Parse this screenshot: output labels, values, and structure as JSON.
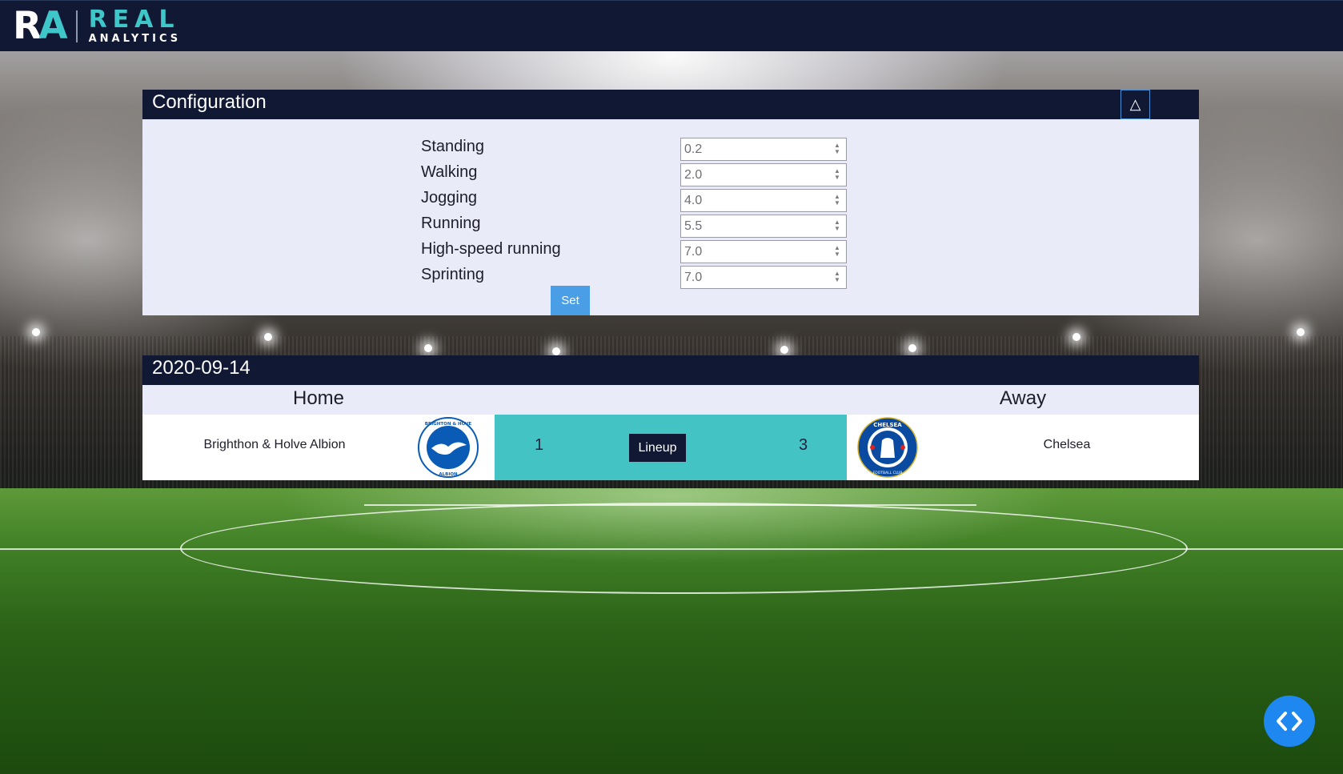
{
  "brand": {
    "mark_r": "R",
    "mark_a": "A",
    "name": "REAL",
    "subname": "ANALYTICS"
  },
  "config": {
    "title": "Configuration",
    "collapse_icon": "△",
    "fields": [
      {
        "label": "Standing",
        "value": "0.2"
      },
      {
        "label": "Walking",
        "value": "2.0"
      },
      {
        "label": "Jogging",
        "value": "4.0"
      },
      {
        "label": "Running",
        "value": "5.5"
      },
      {
        "label": "High-speed running",
        "value": "7.0"
      },
      {
        "label": "Sprinting",
        "value": "7.0"
      }
    ],
    "set_label": "Set"
  },
  "match": {
    "date": "2020-09-14",
    "home_header": "Home",
    "away_header": "Away",
    "home_team": "Brighthon & Holve Albion",
    "away_team": "Chelsea",
    "home_score": "1",
    "away_score": "3",
    "lineup_label": "Lineup",
    "home_crest_top": "BRIGHTON & HOVE",
    "home_crest_bottom": "ALBION",
    "away_crest_top": "CHELSEA",
    "away_crest_bottom": "FOOTBALL CLUB"
  },
  "icons": {
    "nav_toggle": "code-chevrons-icon",
    "collapse": "triangle-up-icon"
  },
  "colors": {
    "navy": "#111834",
    "teal": "#43c3c3",
    "accent_blue": "#4a9ee6",
    "fab_blue": "#1e88f0"
  }
}
